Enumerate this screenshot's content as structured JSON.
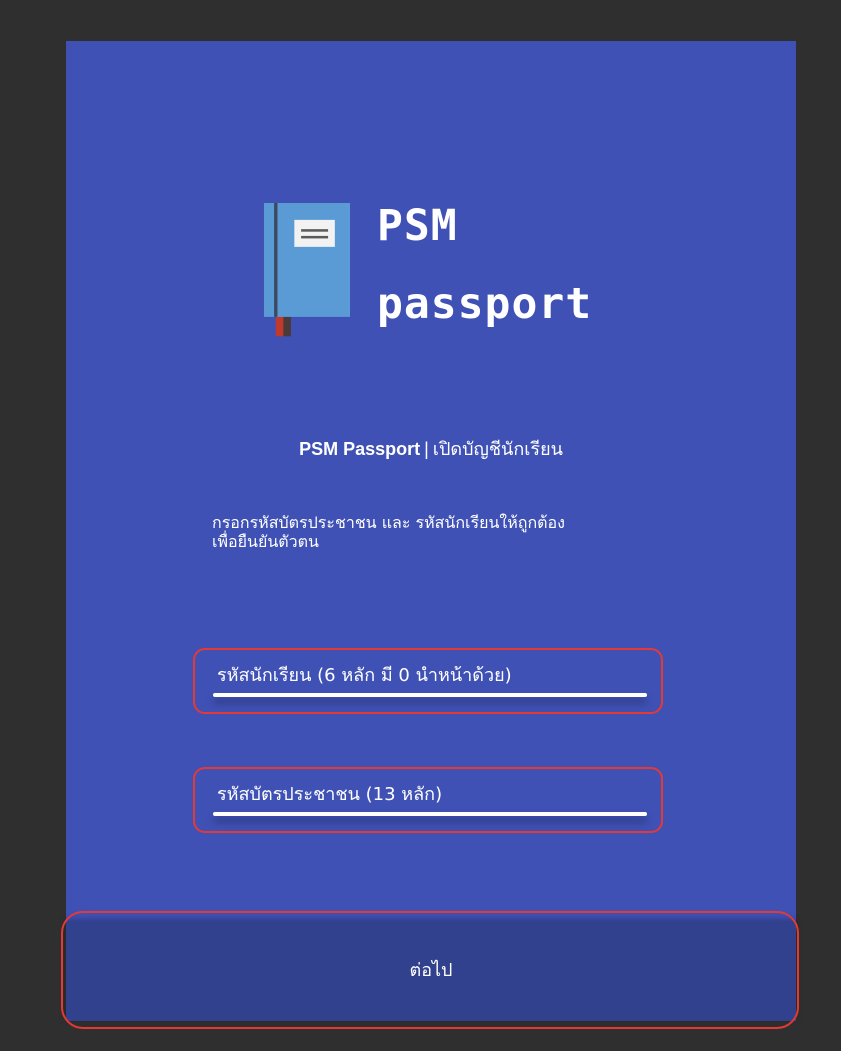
{
  "logo": {
    "icon": "passport-book-icon",
    "brand_line1": "PSM",
    "brand_line2": "passport"
  },
  "header": {
    "app_name": "PSM Passport",
    "separator": "|",
    "page_title": "เปิดบัญชีนักเรียน"
  },
  "instructions": {
    "line1": "กรอกรหัสบัตรประชาชน และ รหัสนักเรียนให้ถูกต้อง",
    "line2": "เพื่อยืนยันตัวตน"
  },
  "form": {
    "student_id": {
      "label": "รหัสนักเรียน (6 หลัก มี 0 นำหน้าด้วย)",
      "value": ""
    },
    "citizen_id": {
      "label": "รหัสบัตรประชาชน (13 หลัก)",
      "value": ""
    }
  },
  "actions": {
    "next_label": "ต่อไป"
  },
  "colors": {
    "background": "#2f2f2f",
    "card": "#3f51b5",
    "button": "#32418e",
    "highlight": "#e53935",
    "text": "#ffffff"
  }
}
